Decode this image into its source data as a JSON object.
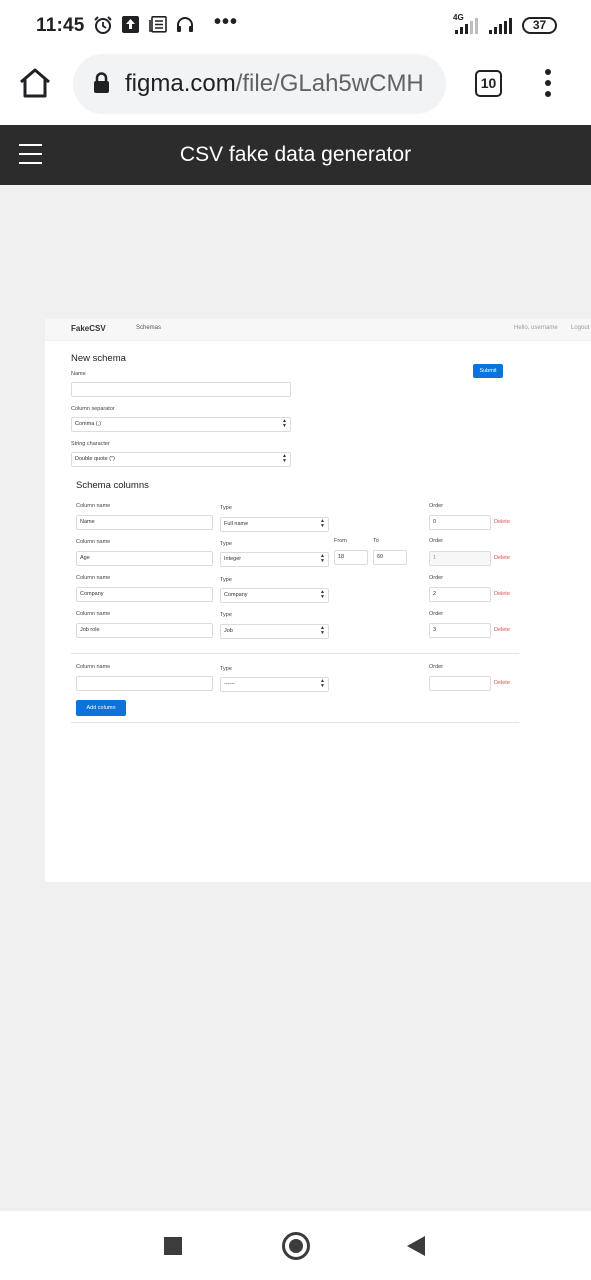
{
  "status_bar": {
    "time": "11:45",
    "dots": "•••",
    "network": "4G",
    "battery": "37",
    "icons": [
      "alarm-icon",
      "upload-icon",
      "news-icon",
      "headphones-icon",
      "signal-icon",
      "signal-icon",
      "battery-icon"
    ]
  },
  "browser": {
    "url_host": "figma.com",
    "url_path": "/file/GLah5wCMH",
    "tab_count": "10",
    "icons": [
      "home-icon",
      "lock-icon",
      "tabs-icon",
      "more-vert-icon"
    ]
  },
  "figma": {
    "title": "CSV fake data generator",
    "icons": [
      "hamburger-menu-icon"
    ]
  },
  "design": {
    "nav": {
      "brand": "FakeCSV",
      "schemas": "Schemas",
      "user": "Hello, username",
      "logout": "Logout"
    },
    "heading": "New schema",
    "submit_label": "Submit",
    "name_label": "Name",
    "name_value": "",
    "separator_label": "Column separator",
    "separator_value": "Comma (,)",
    "string_char_label": "String character",
    "string_char_value": "Double quote (\")",
    "columns_heading": "Schema columns",
    "column_name_label": "Column name",
    "type_label": "Type",
    "order_label": "Order",
    "from_label": "From",
    "to_label": "To",
    "delete_label": "Delete",
    "columns": [
      {
        "name": "Name",
        "type": "Full name",
        "order": "0"
      },
      {
        "name": "Age",
        "type": "Integer",
        "from": "18",
        "to": "60",
        "order": "1"
      },
      {
        "name": "Company",
        "type": "Company",
        "order": "2"
      },
      {
        "name": "Job role",
        "type": "Job",
        "order": "3"
      }
    ],
    "new_column": {
      "name": "",
      "type": "------",
      "order": ""
    },
    "add_column_label": "Add column"
  },
  "colors": {
    "figma_header": "#2c2c2c",
    "canvas": "#f0f0f0",
    "primary": "#0b73d9",
    "delete": "#d9534f"
  }
}
